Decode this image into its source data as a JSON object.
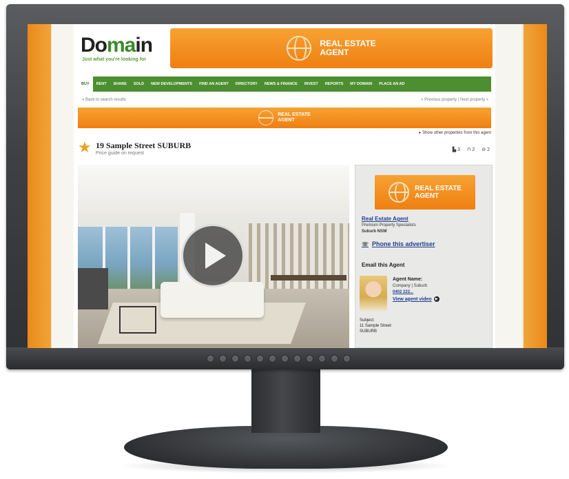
{
  "site": {
    "logo_main": "Do",
    "logo_accent": "ma",
    "logo_end": "in",
    "tagline": "Just what you're looking for"
  },
  "banners": {
    "top": {
      "line1": "REAL ESTATE",
      "line2": "AGENT"
    },
    "mid": {
      "line1": "REAL ESTATE",
      "line2": "AGENT"
    },
    "sidebar": {
      "line1": "REAL ESTATE",
      "line2": "AGENT"
    }
  },
  "nav": {
    "items": [
      {
        "label": "BUY",
        "active": true
      },
      {
        "label": "RENT"
      },
      {
        "label": "SHARE"
      },
      {
        "label": "SOLD"
      },
      {
        "label": "NEW DEVELOPMENTS"
      },
      {
        "label": "FIND AN AGENT"
      },
      {
        "label": "DIRECTORY"
      },
      {
        "label": "NEWS & FINANCE"
      },
      {
        "label": "INVEST"
      },
      {
        "label": "REPORTS"
      },
      {
        "label": "MY DOMAIN"
      },
      {
        "label": "PLACE AN AD"
      }
    ]
  },
  "subbar": {
    "back": "«  Back to search results",
    "pager": "« Previous property  |  Next property  »"
  },
  "listing": {
    "more_link": "▸ Show other properties from this agent",
    "title": "19 Sample Street SUBURB",
    "price": "Price guide on request",
    "features": {
      "beds": "3",
      "baths": "2",
      "cars": "2"
    }
  },
  "agent": {
    "agency_name": "Real Estate Agent",
    "agency_line1": "Premium Property Specialists",
    "agency_line2": "Suburb NSW",
    "phone_label": "Phone this advertiser",
    "email_heading": "Email this Agent",
    "name_label": "Agent Name:",
    "company": "Company | Suburb",
    "phone": "0402 222...",
    "video_label": "View agent video",
    "subject_label": "Subject:",
    "subject_line1": "11 Sample Street",
    "subject_line2": "SUBURB"
  },
  "colors": {
    "accent_orange": "#ef7f12",
    "nav_green": "#4d8f30",
    "link_blue": "#1f3f8f",
    "star": "#f0a020"
  },
  "icons": [
    "globe-icon",
    "play-icon",
    "star-icon",
    "phone-icon",
    "video-icon",
    "bed-icon",
    "bath-icon",
    "car-icon"
  ]
}
